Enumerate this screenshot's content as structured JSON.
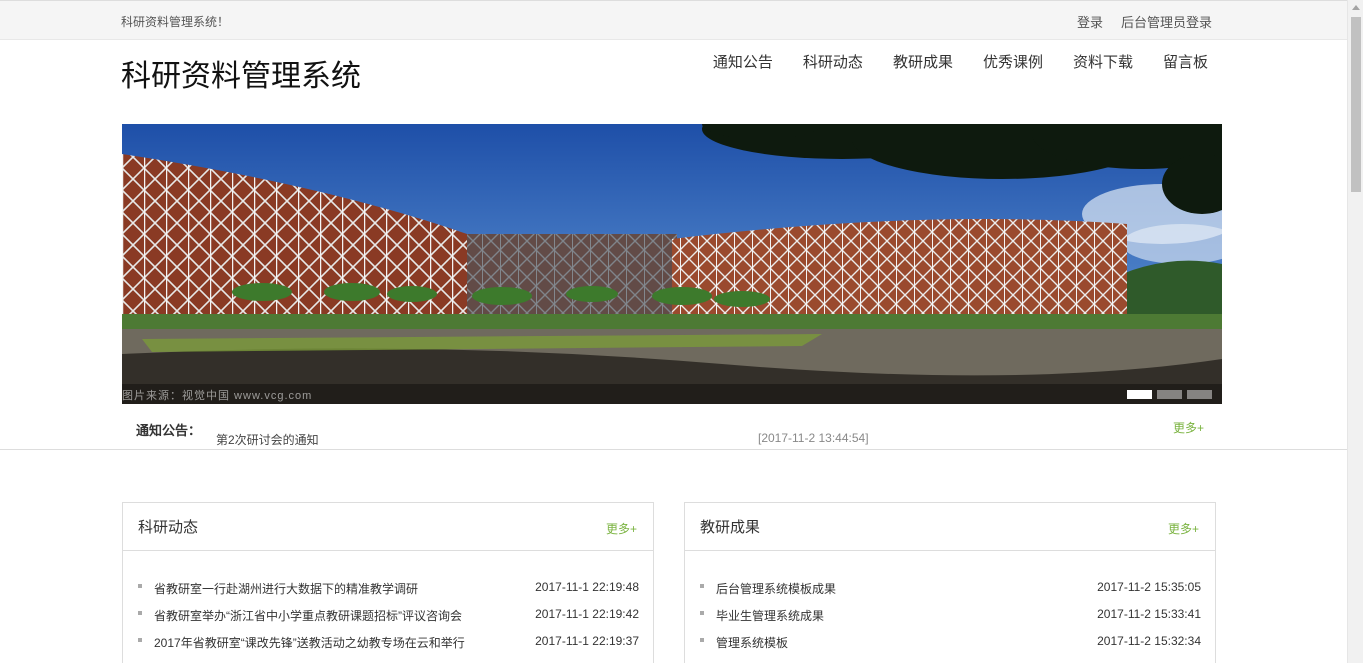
{
  "topbar": {
    "welcome": "科研资料管理系统！",
    "login": "登录",
    "admin_login": "后台管理员登录"
  },
  "header": {
    "title": "科研资料管理系统",
    "nav": [
      "通知公告",
      "科研动态",
      "教研成果",
      "优秀课例",
      "资料下载",
      "留言板"
    ]
  },
  "banner": {
    "credit": "图片来源：视觉中国 www.vcg.com",
    "slides": 3,
    "active_slide": 1
  },
  "notice": {
    "label": "通知公告：",
    "item": "第2次研讨会的通知",
    "time": "[2017-11-2 13:44:54]",
    "more": "更多+"
  },
  "panels": [
    {
      "title": "科研动态",
      "more": "更多+",
      "items": [
        {
          "text": "省教研室一行赴湖州进行大数据下的精准教学调研",
          "date": "2017-11-1 22:19:48"
        },
        {
          "text": "省教研室举办“浙江省中小学重点教研课题招标”评议咨询会",
          "date": "2017-11-1 22:19:42"
        },
        {
          "text": "2017年省教研室“课改先锋”送教活动之幼教专场在云和举行",
          "date": "2017-11-1 22:19:37"
        }
      ]
    },
    {
      "title": "教研成果",
      "more": "更多+",
      "items": [
        {
          "text": "后台管理系统模板成果",
          "date": "2017-11-2 15:35:05"
        },
        {
          "text": "毕业生管理系统成果",
          "date": "2017-11-2 15:33:41"
        },
        {
          "text": "管理系统模板",
          "date": "2017-11-2 15:32:34"
        }
      ]
    }
  ]
}
